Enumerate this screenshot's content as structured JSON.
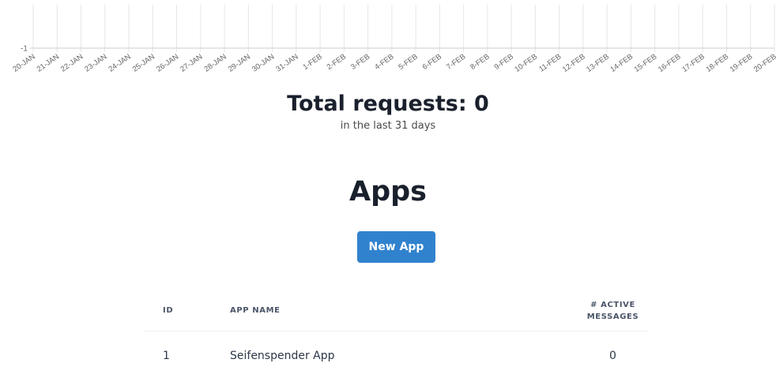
{
  "chart_data": {
    "type": "line",
    "y_tick_label": "-1",
    "x": [
      "20-JAN",
      "21-JAN",
      "22-JAN",
      "23-JAN",
      "24-JAN",
      "25-JAN",
      "26-JAN",
      "27-JAN",
      "28-JAN",
      "29-JAN",
      "30-JAN",
      "31-JAN",
      "1-FEB",
      "2-FEB",
      "3-FEB",
      "4-FEB",
      "5-FEB",
      "6-FEB",
      "7-FEB",
      "8-FEB",
      "9-FEB",
      "10-FEB",
      "11-FEB",
      "12-FEB",
      "13-FEB",
      "14-FEB",
      "15-FEB",
      "16-FEB",
      "17-FEB",
      "18-FEB",
      "19-FEB",
      "20-FEB"
    ],
    "series": [],
    "grid": true,
    "colors": {
      "grid": "#e6e6e6",
      "axis": "#cccccc",
      "tick_text": "#666666"
    }
  },
  "summary": {
    "total_label": "Total requests: 0",
    "subtitle": "in the last 31 days"
  },
  "apps": {
    "heading": "Apps",
    "new_app_label": "New App",
    "columns": {
      "id": "ID",
      "name": "APP NAME",
      "active_line1": "# ACTIVE",
      "active_line2": "MESSAGES"
    },
    "rows": [
      {
        "id": "1",
        "name": "Seifenspender App",
        "active": "0"
      }
    ]
  },
  "colors": {
    "accent": "#3182ce",
    "text": "#1a202c"
  }
}
